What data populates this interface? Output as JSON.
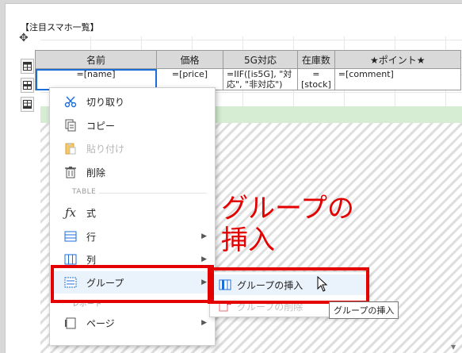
{
  "report": {
    "title": "【注目スマホ一覧】",
    "move_handle": "✥"
  },
  "table": {
    "headers": [
      "名前",
      "価格",
      "5G対応",
      "在庫数",
      "★ポイント★"
    ],
    "detail": [
      "=[name]",
      "=[price]",
      "=IIF([is5G], \"対応\", \"非対応\")",
      "=[stock]",
      "=[comment]"
    ]
  },
  "menu": {
    "items": [
      {
        "label": "切り取り",
        "icon": "scissors-icon",
        "enabled": true
      },
      {
        "label": "コピー",
        "icon": "copy-icon",
        "enabled": true
      },
      {
        "label": "貼り付け",
        "icon": "paste-icon",
        "enabled": false
      },
      {
        "label": "削除",
        "icon": "trash-icon",
        "enabled": true
      }
    ],
    "table_section": "TABLE",
    "table_items": [
      {
        "label": "式",
        "icon": "function-icon",
        "has_submenu": false
      },
      {
        "label": "行",
        "icon": "row-icon",
        "has_submenu": true
      },
      {
        "label": "列",
        "icon": "column-icon",
        "has_submenu": true
      },
      {
        "label": "グループ",
        "icon": "group-icon",
        "has_submenu": true
      }
    ],
    "report_section": "レポート",
    "report_items": [
      {
        "label": "ページ",
        "icon": "page-icon",
        "has_submenu": true
      }
    ]
  },
  "submenu": {
    "items": [
      {
        "label": "グループの挿入",
        "icon": "insert-group-icon",
        "enabled": true
      },
      {
        "label": "グループの削除",
        "icon": "delete-group-icon",
        "enabled": false
      }
    ]
  },
  "annotation": {
    "line1": "グループの",
    "line2": "挿入"
  },
  "tooltip": {
    "text": "グループの挿入"
  },
  "colors": {
    "highlight": "#e40000",
    "header_bg": "#d9d9d9",
    "detail_band": "#d6ecd3",
    "selection": "#1a6ed8"
  }
}
